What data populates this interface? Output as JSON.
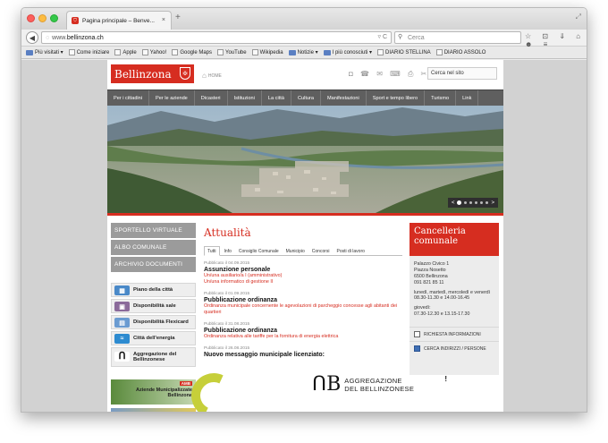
{
  "browser": {
    "tab_title": "Pagina principale – Benve...",
    "tab_close": "×",
    "new_tab": "+",
    "url_prefix": "www.",
    "url_host": "bellinzona.ch",
    "url_right": "▿ C",
    "search_placeholder": "Cerca",
    "nav_icons": "☆ ⊡ ⇓ ⌂ ☻ ≡",
    "bookmarks": [
      {
        "label": "Più visitati ▾",
        "type": "folder"
      },
      {
        "label": "Come iniziare",
        "type": "page"
      },
      {
        "label": "Apple",
        "type": "page"
      },
      {
        "label": "Yahoo!",
        "type": "page"
      },
      {
        "label": "Google Maps",
        "type": "page"
      },
      {
        "label": "YouTube",
        "type": "page"
      },
      {
        "label": "Wikipedia",
        "type": "page"
      },
      {
        "label": "Notizie ▾",
        "type": "folder"
      },
      {
        "label": "I più conosciuti ▾",
        "type": "folder"
      },
      {
        "label": "DIARIO STELLINA",
        "type": "page"
      },
      {
        "label": "DIARIO ASSOLO",
        "type": "page"
      }
    ]
  },
  "site": {
    "logo": "Bellinzona",
    "home_label": "HOME",
    "header_icons": "◘ ☎ ✉ ⌨ ⎙ ✂ ⁂",
    "search_placeholder": "Cerca nel sito",
    "menu": [
      "Per i cittadini",
      "Per le aziende",
      "Dicasteri",
      "Istituzioni",
      "La città",
      "Cultura",
      "Manifestazioni",
      "Sport e tempo libero",
      "Turismo",
      "Link"
    ],
    "slider_prev": "<",
    "slider_next": ">"
  },
  "left": {
    "buttons": [
      "SPORTELLO VIRTUALE",
      "ALBO COMUNALE",
      "ARCHIVIO DOCUMENTI"
    ],
    "quick_links": [
      {
        "label": "Piano della città",
        "color": "#4a89c8"
      },
      {
        "label": "Disponibilità sale",
        "color": "#8b6a9a"
      },
      {
        "label": "Disponibilità Flexicard",
        "color": "#6a9bd1"
      },
      {
        "label": "Città dell'energia",
        "color": "#2d8bd0"
      },
      {
        "label": "Aggregazione del Bellinzonese",
        "color": "#ffffff"
      }
    ],
    "banner_amb": "AMB",
    "banner_text": "Aziende Municipalizzate Bellinzona"
  },
  "news_section": {
    "title": "Attualità",
    "tabs": [
      "Tutti",
      "Info",
      "Consiglio Comunale",
      "Municipio",
      "Concorsi",
      "Posti di lavoro"
    ],
    "items": [
      {
        "date": "Pubblicato il 04.09.2015",
        "title": "Assunzione personale",
        "desc": [
          "Un/una ausiliario/a I (amministrativo)",
          "Un/una informatico di gestione II"
        ]
      },
      {
        "date": "Pubblicato il 01.09.2015",
        "title": "Pubblicazione ordinanza",
        "desc": [
          "Ordinanza municipale concernente le agevolazioni di parcheggio concesse agli abitanti dei quartieri"
        ]
      },
      {
        "date": "Pubblicato il 31.08.2015",
        "title": "Pubblicazione ordinanza",
        "desc": [
          "Ordinanza relativa alle tariffe per la fornitura di energia elettrica"
        ]
      },
      {
        "date": "Pubblicato il 26.08.2015",
        "title": "Nuovo messaggio municipale licenziato:",
        "desc": []
      }
    ],
    "agg_line1": "AGGREGAZIONE",
    "agg_line2": "DEL BELLINZONESE",
    "agg_mark": "ᑎB",
    "excl": "!"
  },
  "right": {
    "title": "Cancelleria comunale",
    "address": [
      "Palazzo Civico 1",
      "Piazza Nosetto",
      "6500 Bellinzona",
      "091 821 85 11"
    ],
    "hours1": [
      "lunedì, martedì, mercoledì e venerdì",
      "08.30-11.30 e 14.00-16.45"
    ],
    "hours2": [
      "giovedì:",
      "07.30-12.30 e 13.15-17.30"
    ],
    "links": [
      "RICHIESTA INFORMAZIONI",
      "CERCA INDIRIZZI / PERSONE"
    ]
  }
}
